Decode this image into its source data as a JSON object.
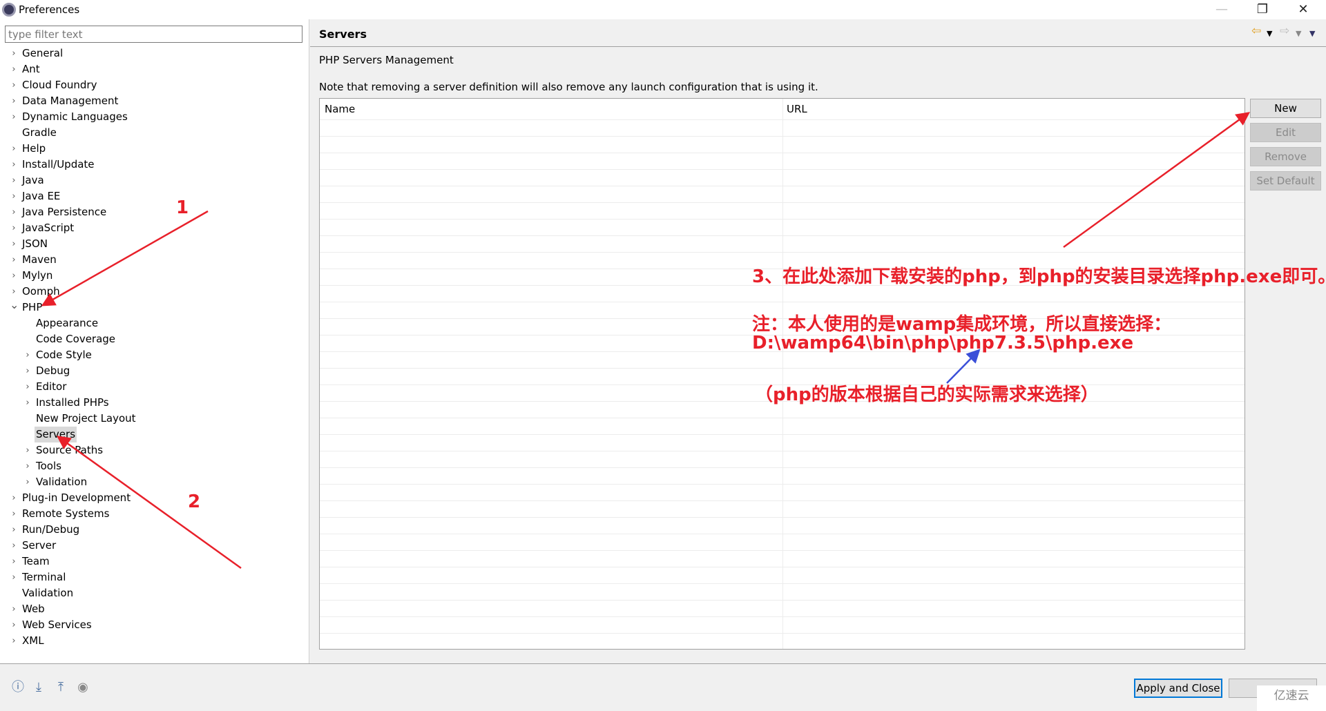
{
  "window": {
    "title": "Preferences",
    "minimize": "—",
    "restore": "❐",
    "close": "✕"
  },
  "filter": {
    "placeholder": "type filter text",
    "value": ""
  },
  "tree": [
    {
      "label": "General",
      "level": 0,
      "expandable": true
    },
    {
      "label": "Ant",
      "level": 0,
      "expandable": true
    },
    {
      "label": "Cloud Foundry",
      "level": 0,
      "expandable": true
    },
    {
      "label": "Data Management",
      "level": 0,
      "expandable": true
    },
    {
      "label": "Dynamic Languages",
      "level": 0,
      "expandable": true
    },
    {
      "label": "Gradle",
      "level": 0,
      "expandable": false
    },
    {
      "label": "Help",
      "level": 0,
      "expandable": true
    },
    {
      "label": "Install/Update",
      "level": 0,
      "expandable": true
    },
    {
      "label": "Java",
      "level": 0,
      "expandable": true
    },
    {
      "label": "Java EE",
      "level": 0,
      "expandable": true
    },
    {
      "label": "Java Persistence",
      "level": 0,
      "expandable": true
    },
    {
      "label": "JavaScript",
      "level": 0,
      "expandable": true
    },
    {
      "label": "JSON",
      "level": 0,
      "expandable": true
    },
    {
      "label": "Maven",
      "level": 0,
      "expandable": true
    },
    {
      "label": "Mylyn",
      "level": 0,
      "expandable": true
    },
    {
      "label": "Oomph",
      "level": 0,
      "expandable": true
    },
    {
      "label": "PHP",
      "level": 0,
      "expandable": true,
      "expanded": true
    },
    {
      "label": "Appearance",
      "level": 1,
      "expandable": false
    },
    {
      "label": "Code Coverage",
      "level": 1,
      "expandable": false
    },
    {
      "label": "Code Style",
      "level": 1,
      "expandable": true
    },
    {
      "label": "Debug",
      "level": 1,
      "expandable": true
    },
    {
      "label": "Editor",
      "level": 1,
      "expandable": true
    },
    {
      "label": "Installed PHPs",
      "level": 1,
      "expandable": true
    },
    {
      "label": "New Project Layout",
      "level": 1,
      "expandable": false
    },
    {
      "label": "Servers",
      "level": 1,
      "expandable": false,
      "selected": true
    },
    {
      "label": "Source Paths",
      "level": 1,
      "expandable": true
    },
    {
      "label": "Tools",
      "level": 1,
      "expandable": true
    },
    {
      "label": "Validation",
      "level": 1,
      "expandable": true
    },
    {
      "label": "Plug-in Development",
      "level": 0,
      "expandable": true
    },
    {
      "label": "Remote Systems",
      "level": 0,
      "expandable": true
    },
    {
      "label": "Run/Debug",
      "level": 0,
      "expandable": true
    },
    {
      "label": "Server",
      "level": 0,
      "expandable": true
    },
    {
      "label": "Team",
      "level": 0,
      "expandable": true
    },
    {
      "label": "Terminal",
      "level": 0,
      "expandable": true
    },
    {
      "label": "Validation",
      "level": 0,
      "expandable": false
    },
    {
      "label": "Web",
      "level": 0,
      "expandable": true
    },
    {
      "label": "Web Services",
      "level": 0,
      "expandable": true
    },
    {
      "label": "XML",
      "level": 0,
      "expandable": true
    }
  ],
  "page": {
    "title": "Servers",
    "subtitle": "PHP Servers Management",
    "note": "Note that removing a server definition will also remove any launch configuration that is using it."
  },
  "table": {
    "columns": [
      "Name",
      "URL"
    ],
    "rows": []
  },
  "buttons": {
    "new": "New",
    "edit": "Edit",
    "remove": "Remove",
    "set_default": "Set Default",
    "apply_close": "Apply and Close"
  },
  "watermark": "亿速云",
  "annotations": {
    "label1": "1",
    "label2": "2",
    "line1": "3、在此处添加下载安装的php，到php的安装目录选择php.exe即可。",
    "line2": "注：本人使用的是wamp集成环境，所以直接选择：",
    "line3": "D:\\wamp64\\bin\\php\\php7.3.5\\php.exe",
    "line4": "（php的版本根据自己的实际需求来选择）",
    "color_red": "#e8202a",
    "color_blue": "#3a4fd8"
  }
}
